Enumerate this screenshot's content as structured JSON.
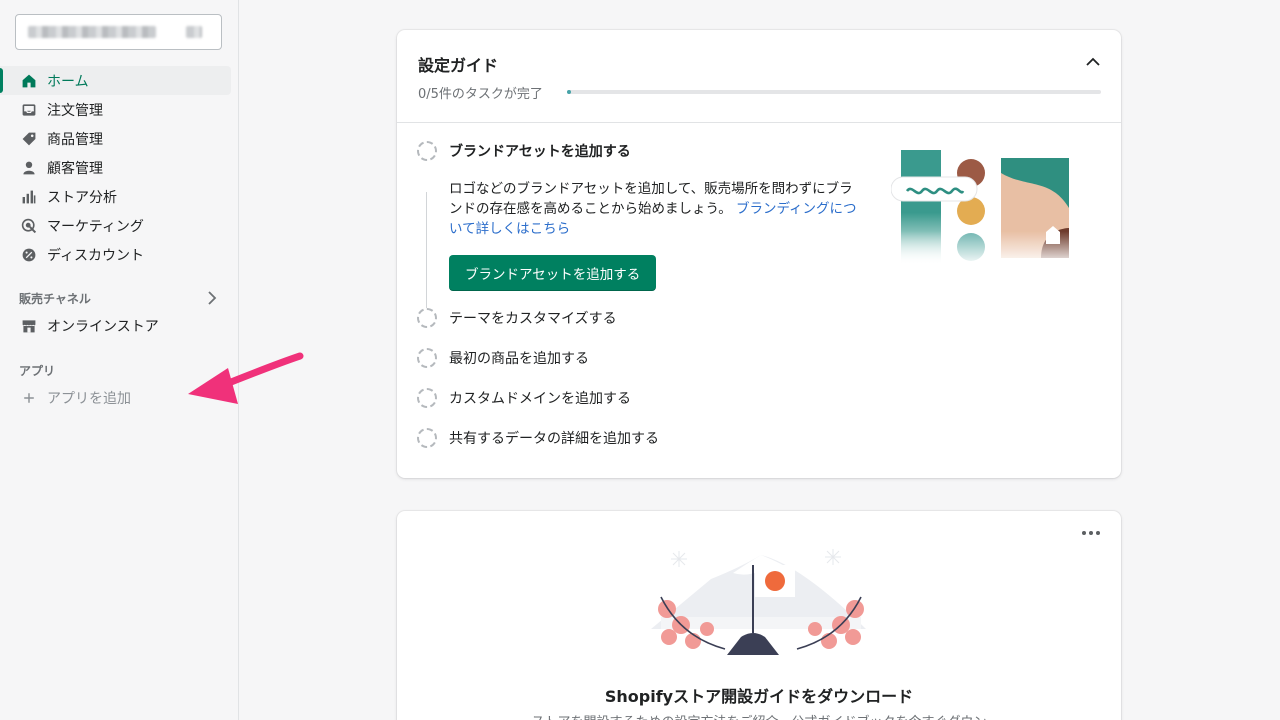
{
  "sidebar": {
    "nav": [
      {
        "label": "ホーム",
        "icon": "home-icon",
        "active": true
      },
      {
        "label": "注文管理",
        "icon": "inbox-icon"
      },
      {
        "label": "商品管理",
        "icon": "tag-icon"
      },
      {
        "label": "顧客管理",
        "icon": "person-icon"
      },
      {
        "label": "ストア分析",
        "icon": "bar-chart-icon"
      },
      {
        "label": "マーケティング",
        "icon": "target-icon"
      },
      {
        "label": "ディスカウント",
        "icon": "discount-icon"
      }
    ],
    "sales_channels": {
      "heading": "販売チャネル",
      "items": [
        {
          "label": "オンラインストア",
          "icon": "store-icon"
        }
      ]
    },
    "apps": {
      "heading": "アプリ",
      "add_label": "アプリを追加"
    }
  },
  "setup_guide": {
    "title": "設定ガイド",
    "progress_text": "0/5件のタスクが完了",
    "progress_completed": 0,
    "progress_total": 5,
    "tasks": [
      {
        "label": "ブランドアセットを追加する"
      },
      {
        "label": "テーマをカスタマイズする"
      },
      {
        "label": "最初の商品を追加する"
      },
      {
        "label": "カスタムドメインを追加する"
      },
      {
        "label": "共有するデータの詳細を追加する"
      }
    ],
    "expanded_desc": "ロゴなどのブランドアセットを追加して、販売場所を問わずにブランドの存在感を高めることから始めましょう。",
    "expanded_link": "ブランディングについて詳しくはこちら",
    "expanded_button": "ブランドアセットを追加する"
  },
  "download_card": {
    "title": "Shopifyストア開設ガイドをダウンロード",
    "subtitle": "ストアを開設するための設定方法をご紹介。公式ガイドブックを今すぐダウン"
  },
  "colors": {
    "accent": "#008060",
    "link": "#2c6ecb",
    "annotation": "#f0317a"
  }
}
